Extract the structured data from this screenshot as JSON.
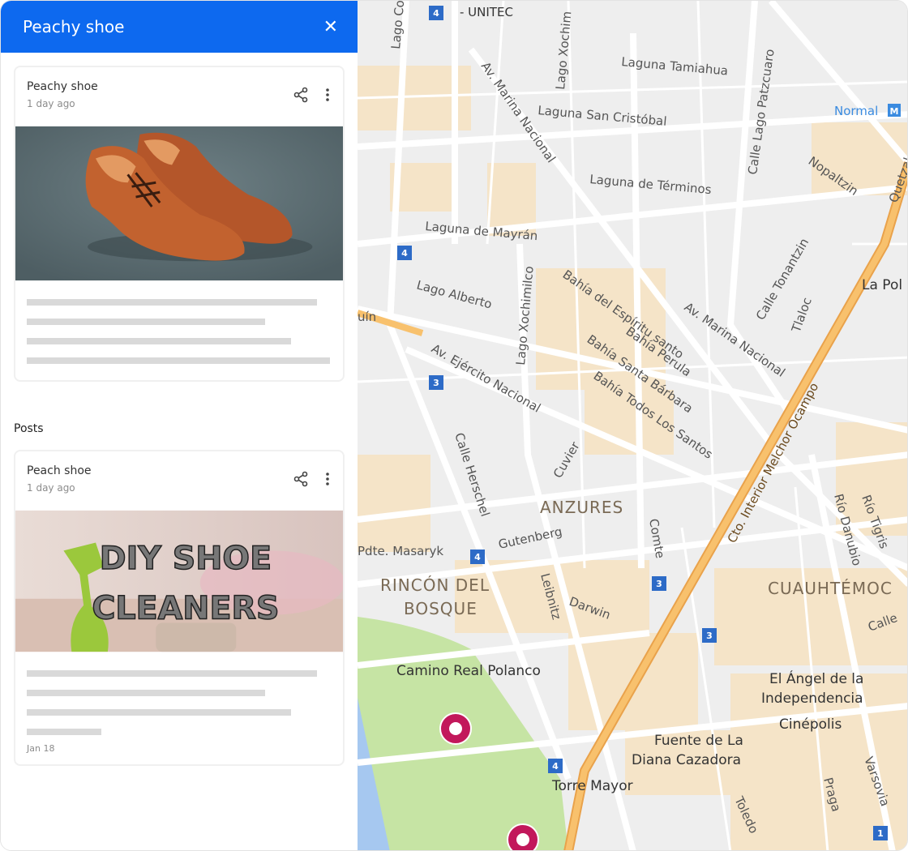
{
  "panel": {
    "title": "Peachy shoe",
    "close_icon": "close-icon",
    "accent": "#0d69ef",
    "posts_label": "Posts"
  },
  "cards": [
    {
      "title": "Peachy shoe",
      "time": "1 day ago",
      "image": "brown brogue shoes"
    },
    {
      "title": "Peach shoe",
      "time": "1 day ago",
      "image_text_1": "DIY SHOE",
      "image_text_2": "CLEANERS",
      "date": "Jan 18"
    }
  ],
  "map": {
    "labels": {
      "unitec": "- UNITEC",
      "tamiahua": "Laguna Tamiahua",
      "normal": "Normal",
      "marina1": "Av. Marina Nacional",
      "cristobal": "Laguna San Cristóbal",
      "patzcuaro": "Calle Lago Patzcuaro",
      "nopaltzin": "Nopaltzin",
      "quetzalcoatl": "Quetzalco",
      "terminos": "Laguna de Términos",
      "mayran": "Laguna de Mayrán",
      "alberto": "Lago Alberto",
      "xochimilco": "Lago Xochimilco",
      "espiritu": "Bahía del Espíritu santo",
      "perula": "Bahía Perula",
      "santabarbara": "Bahía Santa Bárbara",
      "todos": "Bahía Todos Los Santos",
      "marina2": "Av. Marina Nacional",
      "tonantzin": "Calle Tonantzin",
      "tlaloc": "Tlaloc",
      "lapol": "La Pol",
      "ejercito": "Av. Ejército Nacional",
      "melchor": "Cto. Interior Melchor Ocampo",
      "herschel": "Calle Herschel",
      "cuvier": "Cuvier",
      "anzures": "ANZURES",
      "gutenberg": "Gutenberg",
      "masaryk": "Pdte. Masaryk",
      "rincon1": "RINCÓN DEL",
      "rincon2": "BOSQUE",
      "leibnitz": "Leibnitz",
      "darwin": "Darwin",
      "comte": "Comte",
      "danubio": "Río Danubio",
      "tigris": "Río Tigris",
      "cuauhtemoc": "CUAUHTÉMOC",
      "calle": "Calle",
      "caminoreal": "Camino Real Polanco",
      "angel1": "El Ángel de la",
      "angel2": "Independencia",
      "cinepolis": "Cinépolis",
      "fuente1": "Fuente de La",
      "fuente2": "Diana Cazadora",
      "torre": "Torre Mayor",
      "toledo": "Toledo",
      "praga": "Praga",
      "varsovia": "Varsovia",
      "lagocom": "Lago Com",
      "xochim": "Lago Xochim",
      "uin": "uín"
    },
    "route_badges": [
      "4",
      "4",
      "3",
      "4",
      "3",
      "3",
      "4",
      "1"
    ],
    "colors": {
      "road": "#ffffff",
      "block": "#f5e4c8",
      "park": "#c6e4a4",
      "highway": "#f6b25a",
      "bg": "#eeeeee"
    }
  }
}
